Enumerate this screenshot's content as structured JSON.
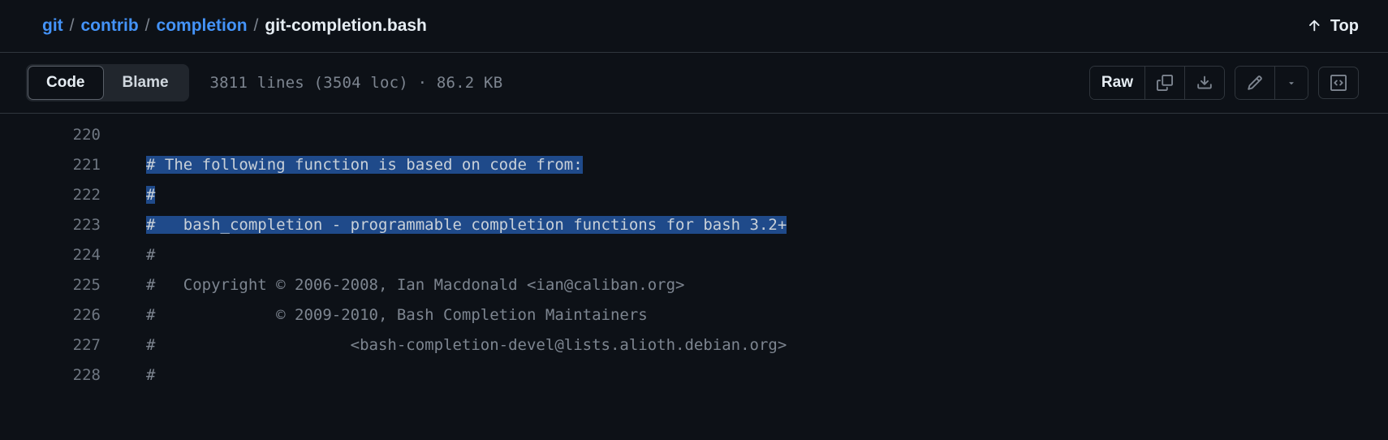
{
  "breadcrumb": {
    "parts": [
      "git",
      "contrib",
      "completion"
    ],
    "current": "git-completion.bash"
  },
  "top_link": {
    "label": "Top"
  },
  "tabs": {
    "code": "Code",
    "blame": "Blame"
  },
  "file_info": "3811 lines (3504 loc) · 86.2 KB",
  "toolbar": {
    "raw": "Raw"
  },
  "code": {
    "lines": [
      {
        "n": "220",
        "text": ""
      },
      {
        "n": "221",
        "text": "# The following function is based on code from:",
        "highlight": true
      },
      {
        "n": "222",
        "text": "#",
        "highlight": true
      },
      {
        "n": "223",
        "text": "#   bash_completion - programmable completion functions for bash 3.2+",
        "highlight": true
      },
      {
        "n": "224",
        "text": "#"
      },
      {
        "n": "225",
        "text": "#   Copyright © 2006-2008, Ian Macdonald <ian@caliban.org>"
      },
      {
        "n": "226",
        "text": "#             © 2009-2010, Bash Completion Maintainers"
      },
      {
        "n": "227",
        "text": "#                     <bash-completion-devel@lists.alioth.debian.org>"
      },
      {
        "n": "228",
        "text": "#"
      }
    ]
  }
}
